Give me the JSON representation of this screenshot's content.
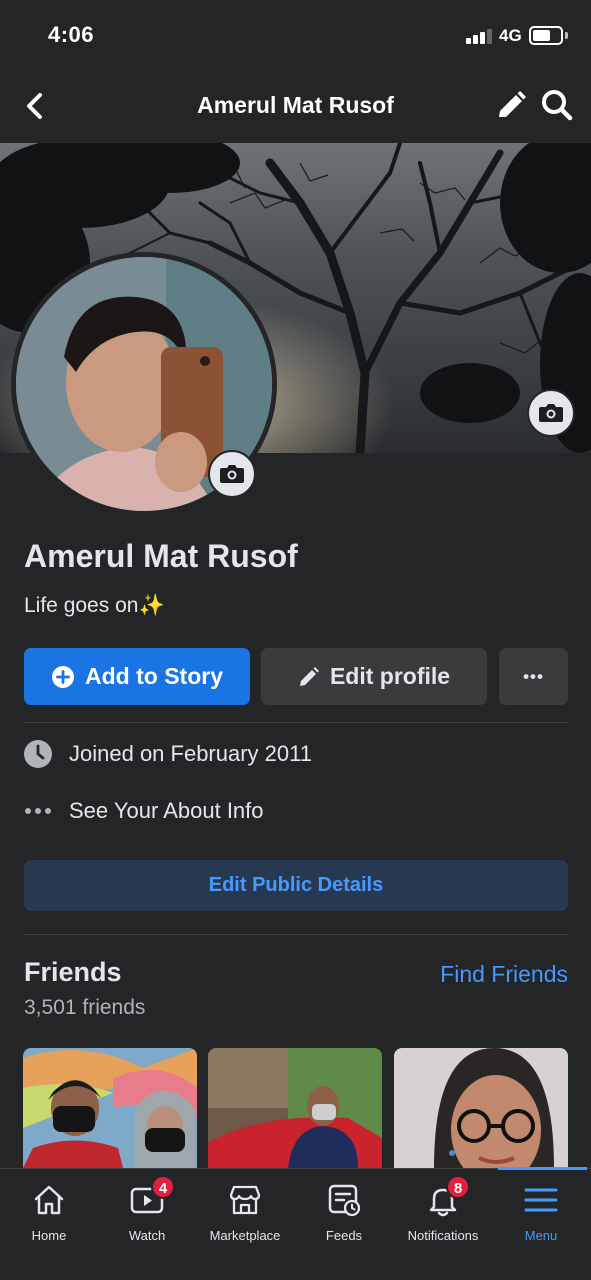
{
  "status_bar": {
    "time": "4:06",
    "network": "4G",
    "battery_level": 0.65,
    "signal_bars": 3
  },
  "nav": {
    "title": "Amerul Mat Rusof"
  },
  "profile": {
    "name": "Amerul Mat Rusof",
    "bio": "Life goes on",
    "bio_emoji": "✨"
  },
  "actions": {
    "add_story": "Add to Story",
    "edit_profile": "Edit profile",
    "more": "•••"
  },
  "info": {
    "joined": "Joined on February 2011",
    "about": "See Your About Info"
  },
  "edit_public_details": "Edit Public Details",
  "friends": {
    "title": "Friends",
    "count": "3,501 friends",
    "find_label": "Find Friends"
  },
  "tabs": [
    {
      "label": "Home",
      "icon": "home-icon"
    },
    {
      "label": "Watch",
      "icon": "watch-icon",
      "badge": "4"
    },
    {
      "label": "Marketplace",
      "icon": "marketplace-icon"
    },
    {
      "label": "Feeds",
      "icon": "feeds-icon"
    },
    {
      "label": "Notifications",
      "icon": "bell-icon",
      "badge": "8"
    },
    {
      "label": "Menu",
      "icon": "menu-icon",
      "active": true
    }
  ],
  "colors": {
    "background": "#242526",
    "primary_blue": "#1b74e4",
    "link_blue": "#4599ff",
    "badge_red": "#e41e3f"
  }
}
